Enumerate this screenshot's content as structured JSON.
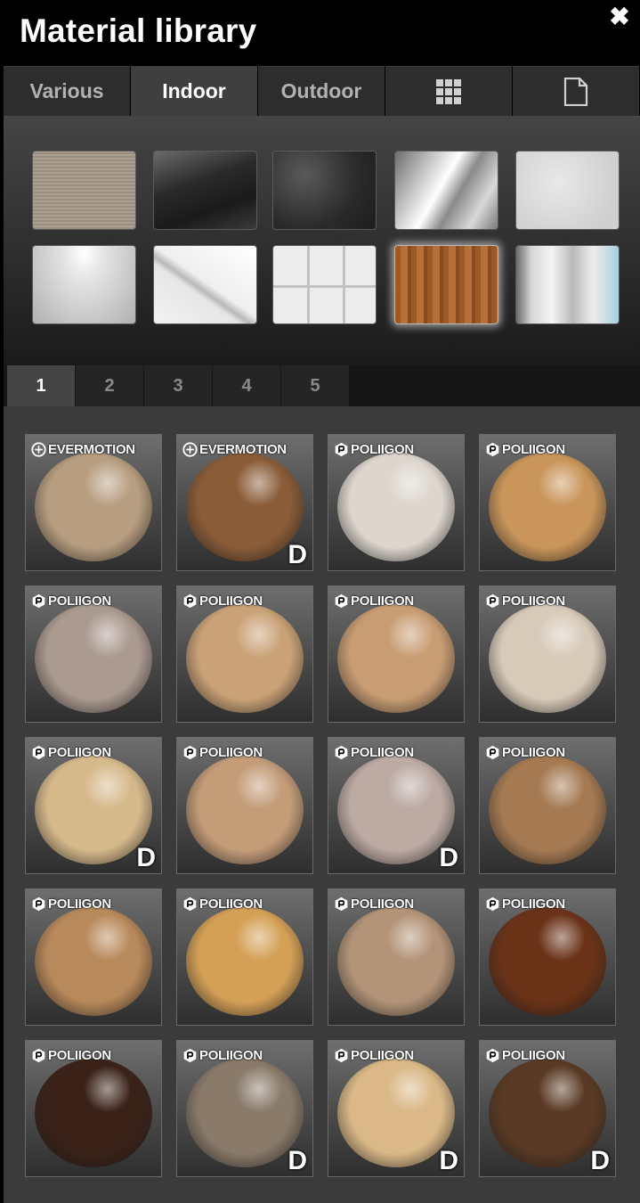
{
  "window": {
    "title": "Material library",
    "close_label": "✖"
  },
  "tabs": [
    {
      "label": "Various",
      "active": false
    },
    {
      "label": "Indoor",
      "active": true
    },
    {
      "label": "Outdoor",
      "active": false
    },
    {
      "label": "",
      "icon": "grid-icon"
    },
    {
      "label": "",
      "icon": "document-icon"
    }
  ],
  "categories": [
    {
      "name": "fabric",
      "selected": false
    },
    {
      "name": "glossy-dark",
      "selected": false
    },
    {
      "name": "leather",
      "selected": false
    },
    {
      "name": "brushed-metal",
      "selected": false
    },
    {
      "name": "stucco",
      "selected": false
    },
    {
      "name": "glossy-white",
      "selected": false
    },
    {
      "name": "marble",
      "selected": false
    },
    {
      "name": "tiles",
      "selected": false
    },
    {
      "name": "wood",
      "selected": true
    },
    {
      "name": "curtain",
      "selected": false
    }
  ],
  "pages": [
    "1",
    "2",
    "3",
    "4",
    "5"
  ],
  "active_page": "1",
  "materials": [
    {
      "brand": "EVERMOTION",
      "download": "",
      "color": "#b89e80"
    },
    {
      "brand": "EVERMOTION",
      "download": "D",
      "color": "#8a5c38"
    },
    {
      "brand": "POLIIGON",
      "download": "",
      "color": "#dcd6cd"
    },
    {
      "brand": "POLIIGON",
      "download": "",
      "color": "#c9955a"
    },
    {
      "brand": "POLIIGON",
      "download": "",
      "color": "#ab9a8f"
    },
    {
      "brand": "POLIIGON",
      "download": "",
      "color": "#caa277"
    },
    {
      "brand": "POLIIGON",
      "download": "",
      "color": "#c89d73"
    },
    {
      "brand": "POLIIGON",
      "download": "",
      "color": "#d8cab9"
    },
    {
      "brand": "POLIIGON",
      "download": "D",
      "color": "#d6b98b"
    },
    {
      "brand": "POLIIGON",
      "download": "",
      "color": "#c39c78"
    },
    {
      "brand": "POLIIGON",
      "download": "D",
      "color": "#bcaaa3"
    },
    {
      "brand": "POLIIGON",
      "download": "",
      "color": "#a57a52"
    },
    {
      "brand": "POLIIGON",
      "download": "",
      "color": "#b8895a"
    },
    {
      "brand": "POLIIGON",
      "download": "",
      "color": "#d4a056"
    },
    {
      "brand": "POLIIGON",
      "download": "",
      "color": "#b49478"
    },
    {
      "brand": "POLIIGON",
      "download": "",
      "color": "#6a3318"
    },
    {
      "brand": "POLIIGON",
      "download": "",
      "color": "#3a2218"
    },
    {
      "brand": "POLIIGON",
      "download": "D",
      "color": "#8a7a6a"
    },
    {
      "brand": "POLIIGON",
      "download": "D",
      "color": "#dab887"
    },
    {
      "brand": "POLIIGON",
      "download": "D",
      "color": "#5a3a24"
    }
  ]
}
